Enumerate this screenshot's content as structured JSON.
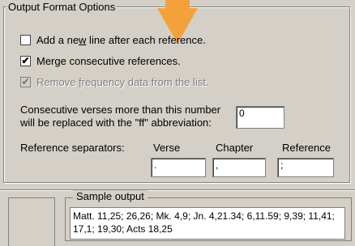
{
  "group": {
    "title": "Output Format Options"
  },
  "options": [
    {
      "label_pre": "Add a ne",
      "label_u": "w",
      "label_post": " line after each reference.",
      "checked": false,
      "enabled": true
    },
    {
      "label_pre": "Mer",
      "label_u": "g",
      "label_post": "e consecutive references.",
      "checked": true,
      "enabled": true
    },
    {
      "label_pre": "Remove ",
      "label_u": "f",
      "label_post": "requency data from the list.",
      "checked": true,
      "enabled": false
    }
  ],
  "consecutive": {
    "line1": "Consecutive verses more than this number",
    "line2": "will be replaced with the \"ff\" abbreviation:",
    "value": "0"
  },
  "separators": {
    "label": "Reference separators:",
    "verse_label": "Verse",
    "chapter_label": "Chapter",
    "reference_label": "Reference",
    "verse_value": ".",
    "chapter_value": ",",
    "reference_value": ";"
  },
  "sample": {
    "title": "Sample output",
    "text": "Matt. 11,25; 26,26; Mk. 4,9; Jn. 4,21.34; 6,11.59; 9,39; 11,41; 17,1; 19,30; Acts 18,25"
  },
  "colors": {
    "accent_arrow": "#f4a13c"
  }
}
